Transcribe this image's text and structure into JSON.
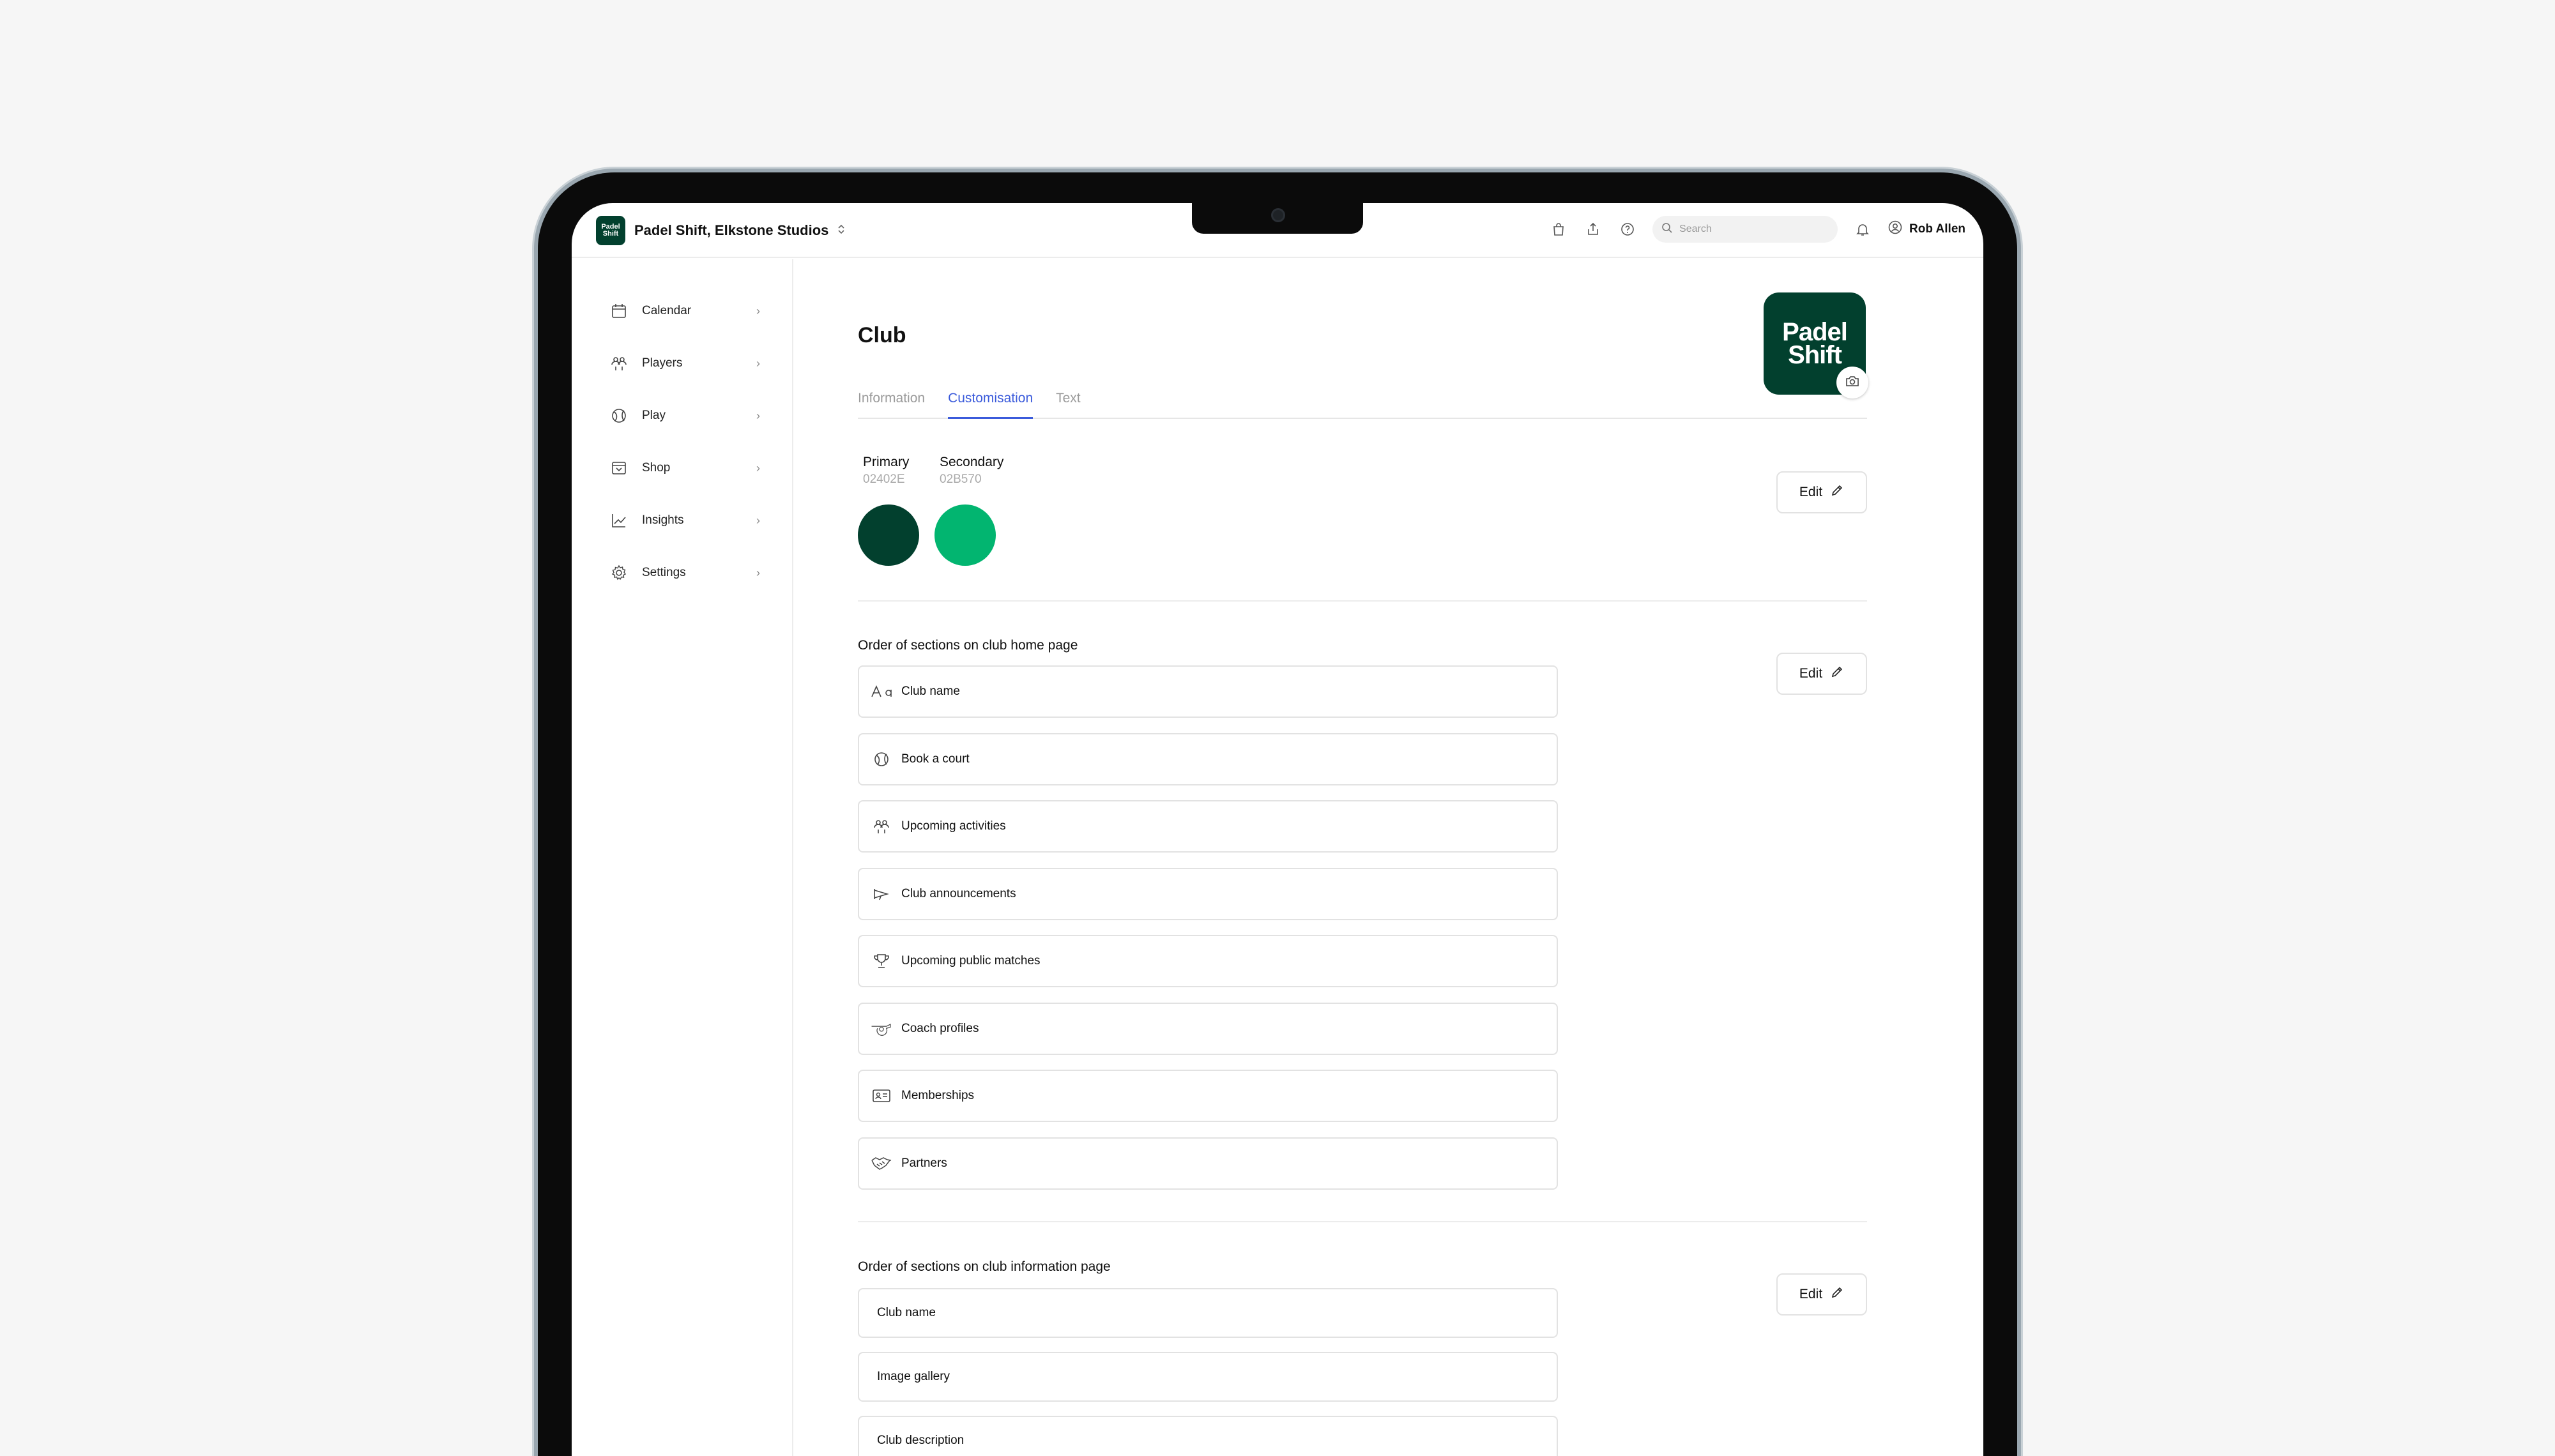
{
  "header": {
    "club_selector": "Padel Shift, Elkstone Studios",
    "brand_logo_text": "Padel Shift",
    "search_placeholder": "Search",
    "user_name": "Rob Allen"
  },
  "sidebar": {
    "items": [
      {
        "label": "Calendar",
        "icon": "calendar-icon"
      },
      {
        "label": "Players",
        "icon": "players-icon"
      },
      {
        "label": "Play",
        "icon": "ball-icon"
      },
      {
        "label": "Shop",
        "icon": "shop-icon"
      },
      {
        "label": "Insights",
        "icon": "chart-icon"
      },
      {
        "label": "Settings",
        "icon": "gear-icon"
      }
    ]
  },
  "page": {
    "title": "Club",
    "logo_text_line1": "Padel",
    "logo_text_line2": "Shift",
    "tabs": [
      {
        "label": "Information",
        "active": false
      },
      {
        "label": "Customisation",
        "active": true
      },
      {
        "label": "Text",
        "active": false
      }
    ]
  },
  "colors": {
    "primary": {
      "label": "Primary",
      "hex_label": "02402E",
      "hex": "#02402E"
    },
    "secondary": {
      "label": "Secondary",
      "hex_label": "02B570",
      "hex": "#02B570"
    },
    "edit_label": "Edit"
  },
  "home_sections": {
    "title": "Order of sections on club home page",
    "edit_label": "Edit",
    "items": [
      {
        "label": "Club name",
        "icon": "text-icon"
      },
      {
        "label": "Book a court",
        "icon": "ball-icon"
      },
      {
        "label": "Upcoming activities",
        "icon": "players-icon"
      },
      {
        "label": "Club announcements",
        "icon": "megaphone-icon"
      },
      {
        "label": "Upcoming public matches",
        "icon": "trophy-icon"
      },
      {
        "label": "Coach profiles",
        "icon": "whistle-icon"
      },
      {
        "label": "Memberships",
        "icon": "id-card-icon"
      },
      {
        "label": "Partners",
        "icon": "handshake-icon"
      }
    ]
  },
  "info_sections": {
    "title": "Order of sections on club information page",
    "edit_label": "Edit",
    "items": [
      {
        "label": "Club name"
      },
      {
        "label": "Image gallery"
      },
      {
        "label": "Club description"
      }
    ]
  }
}
